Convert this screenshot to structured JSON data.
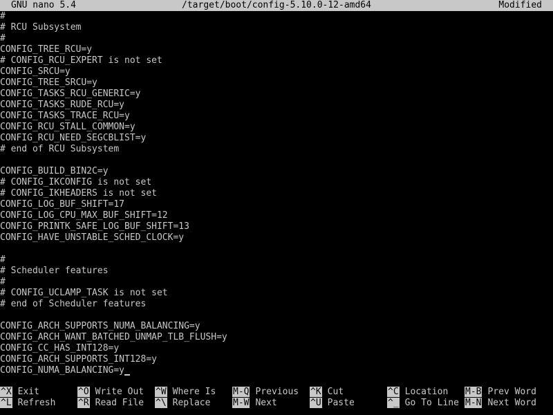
{
  "titlebar": {
    "version": "GNU nano 5.4",
    "filename": "/target/boot/config-5.10.0-12-amd64",
    "status": "Modified"
  },
  "editor": {
    "lines": [
      "#",
      "# RCU Subsystem",
      "#",
      "CONFIG_TREE_RCU=y",
      "# CONFIG_RCU_EXPERT is not set",
      "CONFIG_SRCU=y",
      "CONFIG_TREE_SRCU=y",
      "CONFIG_TASKS_RCU_GENERIC=y",
      "CONFIG_TASKS_RUDE_RCU=y",
      "CONFIG_TASKS_TRACE_RCU=y",
      "CONFIG_RCU_STALL_COMMON=y",
      "CONFIG_RCU_NEED_SEGCBLIST=y",
      "# end of RCU Subsystem",
      "",
      "CONFIG_BUILD_BIN2C=y",
      "# CONFIG_IKCONFIG is not set",
      "# CONFIG_IKHEADERS is not set",
      "CONFIG_LOG_BUF_SHIFT=17",
      "CONFIG_LOG_CPU_MAX_BUF_SHIFT=12",
      "CONFIG_PRINTK_SAFE_LOG_BUF_SHIFT=13",
      "CONFIG_HAVE_UNSTABLE_SCHED_CLOCK=y",
      "",
      "#",
      "# Scheduler features",
      "#",
      "# CONFIG_UCLAMP_TASK is not set",
      "# end of Scheduler features",
      "",
      "CONFIG_ARCH_SUPPORTS_NUMA_BALANCING=y",
      "CONFIG_ARCH_WANT_BATCHED_UNMAP_TLB_FLUSH=y",
      "CONFIG_CC_HAS_INT128=y",
      "CONFIG_ARCH_SUPPORTS_INT128=y",
      "CONFIG_NUMA_BALANCING=y"
    ]
  },
  "shortcuts": {
    "row1": [
      {
        "key": "^X",
        "label": "Exit"
      },
      {
        "key": "^O",
        "label": "Write Out"
      },
      {
        "key": "^W",
        "label": "Where Is"
      },
      {
        "key": "M-Q",
        "label": "Previous"
      },
      {
        "key": "^K",
        "label": "Cut"
      },
      {
        "key": "^C",
        "label": "Location"
      },
      {
        "key": "M-B",
        "label": "Prev Word"
      }
    ],
    "row2": [
      {
        "key": "^L",
        "label": "Refresh"
      },
      {
        "key": "^R",
        "label": "Read File"
      },
      {
        "key": "^\\",
        "label": "Replace"
      },
      {
        "key": "M-W",
        "label": "Next"
      },
      {
        "key": "^U",
        "label": "Paste"
      },
      {
        "key": "^_",
        "label": "Go To Line"
      },
      {
        "key": "M-N",
        "label": "Next Word"
      }
    ]
  },
  "colors": {
    "background": "#000000",
    "foreground": "#c8c8c8",
    "inverse_bg": "#c8c8c8",
    "inverse_fg": "#000000"
  }
}
